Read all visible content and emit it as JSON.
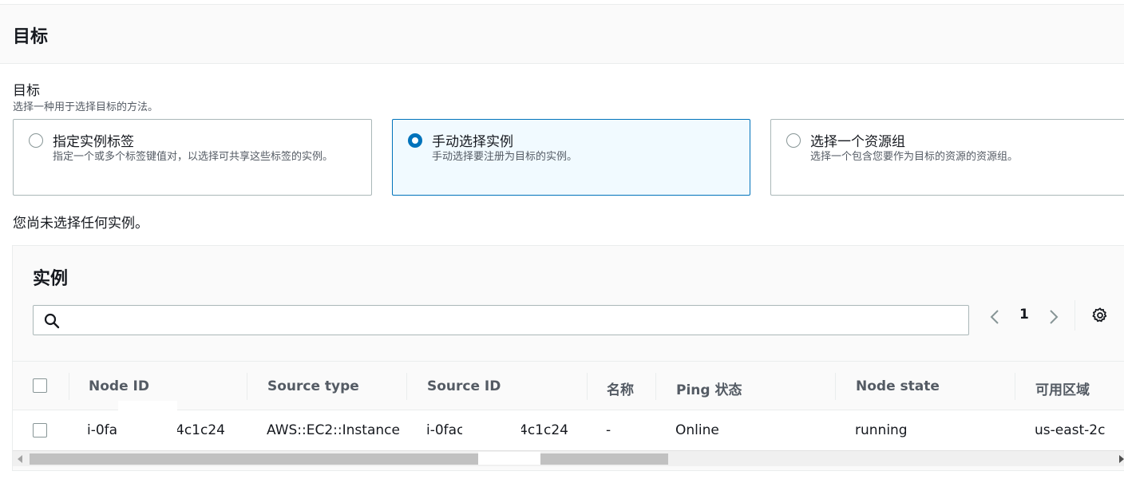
{
  "section": {
    "title": "目标"
  },
  "field": {
    "label": "目标",
    "description": "选择一种用于选择目标的方法。"
  },
  "tiles": [
    {
      "title": "指定实例标签",
      "description": "指定一个或多个标签键值对，以选择可共享这些标签的实例。",
      "selected": false
    },
    {
      "title": "手动选择实例",
      "description": "手动选择要注册为目标的实例。",
      "selected": true
    },
    {
      "title": "选择一个资源组",
      "description": "选择一个包含您要作为目标的资源的资源组。",
      "selected": false
    }
  ],
  "no_selection_text": "您尚未选择任何实例。",
  "instances": {
    "title": "实例",
    "search": {
      "placeholder": "",
      "icon": "search-icon"
    },
    "pagination": {
      "current_page": "1",
      "prev_icon": "chevron-left-icon",
      "next_icon": "chevron-right-icon"
    },
    "settings_icon": "gear-icon",
    "columns": [
      "Node ID",
      "Source type",
      "Source ID",
      "名称",
      "Ping 状态",
      "Node state",
      "可用区域"
    ],
    "rows": [
      {
        "node_id_prefix": "i-0fa",
        "node_id_suffix": "4c1c24",
        "source_type": "AWS::EC2::Instance",
        "source_id_prefix": "i-0fac",
        "source_id_suffix": "4c1c24",
        "name": "-",
        "ping_status": "Online",
        "node_state": "running",
        "availability_zone": "us-east-2c",
        "checked": false
      }
    ]
  }
}
